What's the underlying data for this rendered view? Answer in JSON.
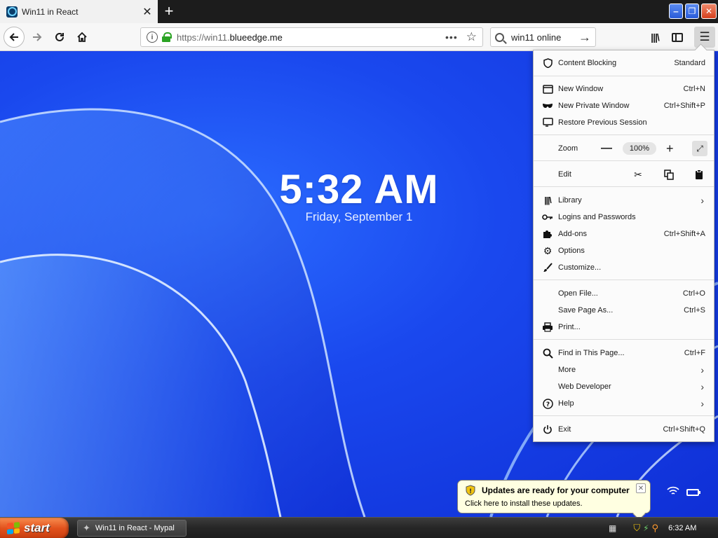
{
  "window": {
    "tab_title": "Win11 in React",
    "close_glyph": "✕",
    "newtab_glyph": "+",
    "min_glyph": "‒",
    "max_glyph": "❐",
    "winclose_glyph": "✕"
  },
  "nav": {
    "url_scheme": "https://win11.",
    "url_host": "blueedge.me",
    "search_text": "win11 online",
    "dots": "•••"
  },
  "desktop": {
    "time": "5:32 AM",
    "date": "Friday, September 1"
  },
  "menu": {
    "content_blocking": {
      "label": "Content Blocking",
      "value": "Standard"
    },
    "new_window": {
      "label": "New Window",
      "shortcut": "Ctrl+N"
    },
    "new_private": {
      "label": "New Private Window",
      "shortcut": "Ctrl+Shift+P"
    },
    "restore": {
      "label": "Restore Previous Session"
    },
    "zoom": {
      "label": "Zoom",
      "level": "100%"
    },
    "edit": {
      "label": "Edit"
    },
    "library": {
      "label": "Library"
    },
    "logins": {
      "label": "Logins and Passwords"
    },
    "addons": {
      "label": "Add-ons",
      "shortcut": "Ctrl+Shift+A"
    },
    "options": {
      "label": "Options"
    },
    "customize": {
      "label": "Customize..."
    },
    "open_file": {
      "label": "Open File...",
      "shortcut": "Ctrl+O"
    },
    "save_page": {
      "label": "Save Page As...",
      "shortcut": "Ctrl+S"
    },
    "print": {
      "label": "Print..."
    },
    "find": {
      "label": "Find in This Page...",
      "shortcut": "Ctrl+F"
    },
    "more": {
      "label": "More"
    },
    "webdev": {
      "label": "Web Developer"
    },
    "help": {
      "label": "Help"
    },
    "exit": {
      "label": "Exit",
      "shortcut": "Ctrl+Shift+Q"
    }
  },
  "balloon": {
    "title": "Updates are ready for your computer",
    "text": "Click here to install these updates."
  },
  "taskbar": {
    "start_label": "start",
    "task_label": "Win11 in React - Mypal",
    "clock": "6:32 AM"
  },
  "colors": {
    "accent_blue": "#1a48ee",
    "start_orange": "#e2521d",
    "lock_green": "#2ba324"
  }
}
